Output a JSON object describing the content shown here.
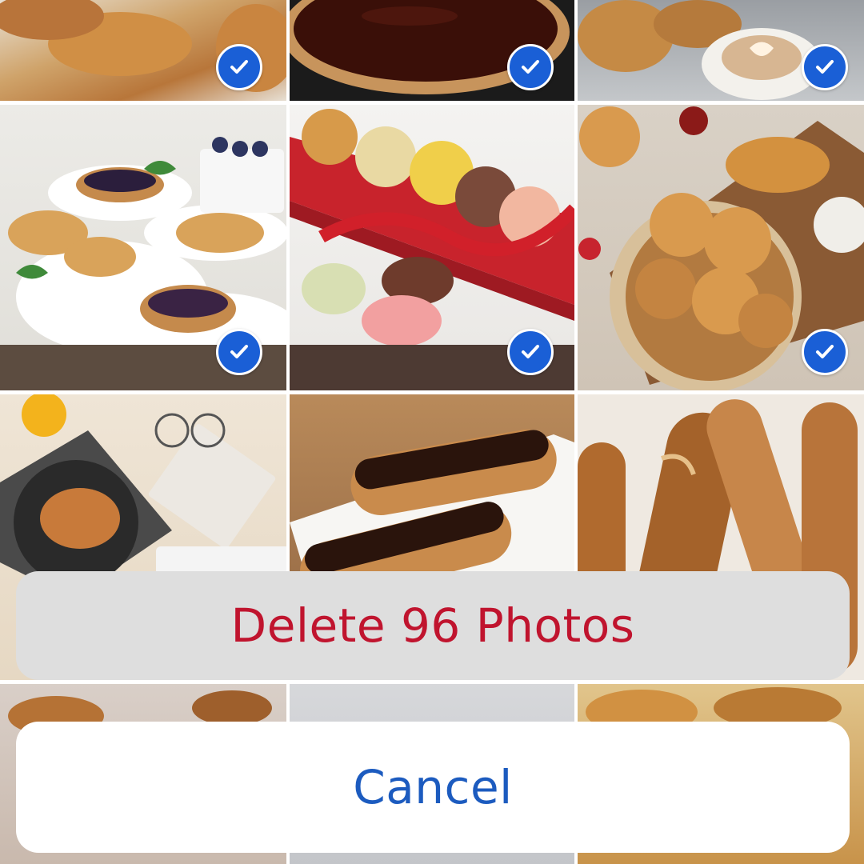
{
  "action_sheet": {
    "delete_label": "Delete 96 Photos",
    "cancel_label": "Cancel",
    "delete_color": "#c0142e",
    "cancel_color": "#1c5bbf"
  },
  "selection": {
    "check_color": "#1a5fd6"
  },
  "photos": [
    {
      "subject": "croissants-basket",
      "selected": true
    },
    {
      "subject": "chocolate-tart",
      "selected": true
    },
    {
      "subject": "pastries-and-latte",
      "selected": true
    },
    {
      "subject": "fruit-tarts",
      "selected": true
    },
    {
      "subject": "macarons-red-box",
      "selected": true
    },
    {
      "subject": "viennoiserie-board",
      "selected": true
    },
    {
      "subject": "pain-au-chocolat-desk",
      "selected": false
    },
    {
      "subject": "chocolate-eclairs",
      "selected": false
    },
    {
      "subject": "baguettes",
      "selected": false
    },
    {
      "subject": "pastry-partial-left",
      "selected": false
    },
    {
      "subject": "pastry-partial-center",
      "selected": false
    },
    {
      "subject": "pastry-partial-right",
      "selected": false
    }
  ]
}
